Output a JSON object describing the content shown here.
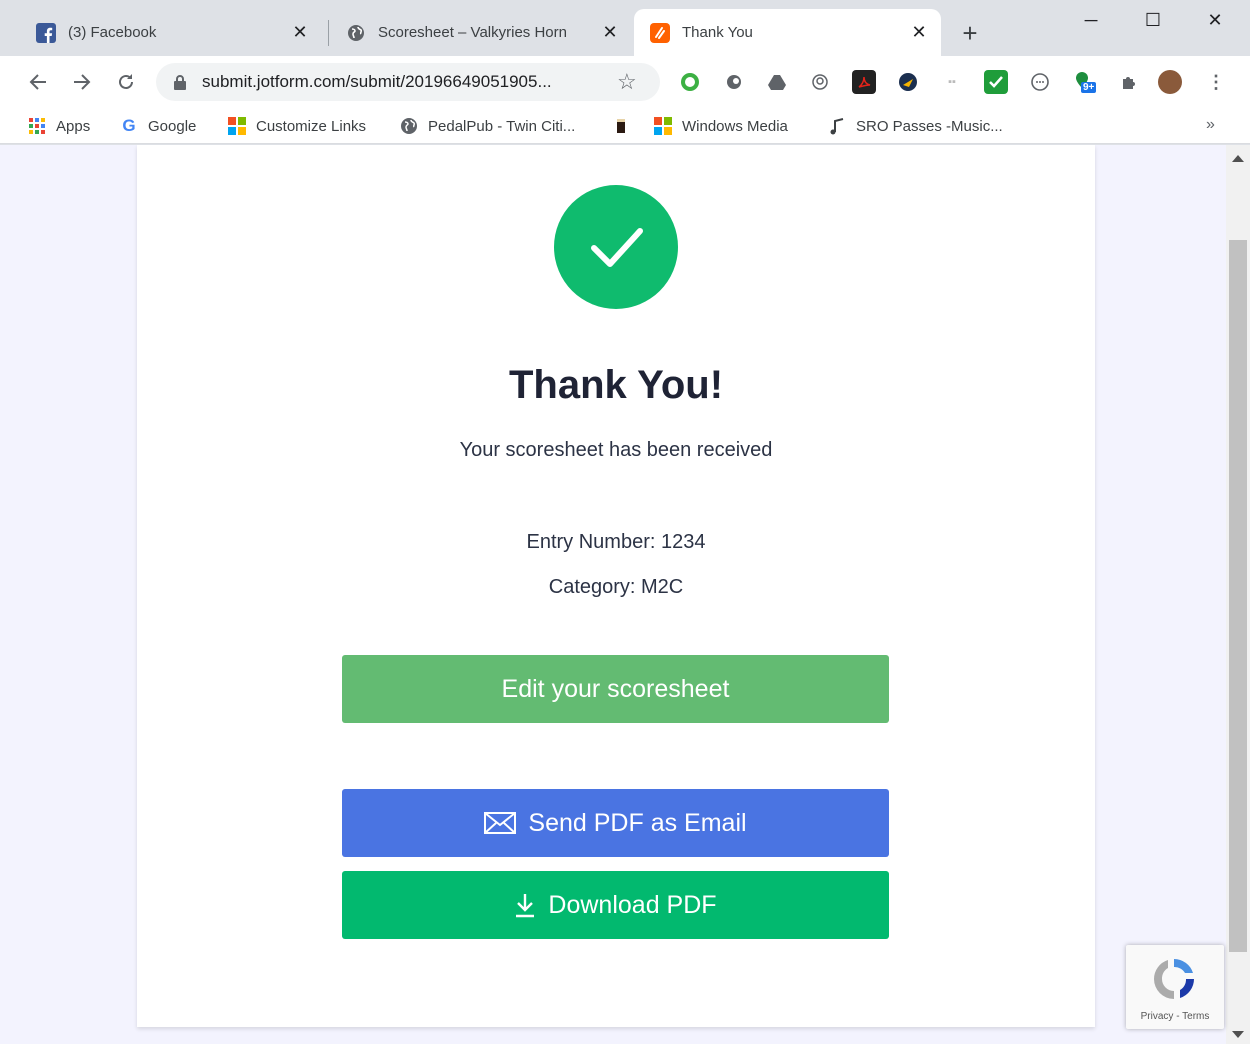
{
  "browser": {
    "tabs": [
      {
        "label": "(3) Facebook",
        "close": "✕"
      },
      {
        "label": "Scoresheet – Valkyries Horn",
        "close": "✕"
      },
      {
        "label": "Thank You",
        "close": "✕"
      }
    ],
    "new_tab": "+",
    "window_controls": {
      "minimize": "─",
      "maximize": "☐",
      "close": "✕"
    },
    "url": "submit.jotform.com/submit/20196649051905...",
    "extension_badge": "9+"
  },
  "bookmarks": [
    {
      "label": "Apps",
      "icon": "apps-grid-icon"
    },
    {
      "label": "Google",
      "icon": "google-icon"
    },
    {
      "label": "Customize Links",
      "icon": "windows-icon"
    },
    {
      "label": "PedalPub - Twin Citi...",
      "icon": "globe-icon"
    },
    {
      "label": "",
      "icon": "beer-icon"
    },
    {
      "label": "Windows Media",
      "icon": "windows-icon"
    },
    {
      "label": "SRO Passes -Music...",
      "icon": "music-note-icon"
    }
  ],
  "bookmarks_more": "»",
  "page": {
    "headline": "Thank You!",
    "subline": "Your scoresheet has been received",
    "entry": "Entry Number: 1234",
    "category": "Category: M2C",
    "edit_button": "Edit your scoresheet",
    "email_button": "Send PDF as Email",
    "download_button": "Download PDF"
  },
  "recaptcha": {
    "terms": "Privacy - Terms"
  },
  "colors": {
    "success": "#0fbb6e",
    "edit": "#63bb72",
    "email": "#4a74e2",
    "download": "#02b96f"
  }
}
